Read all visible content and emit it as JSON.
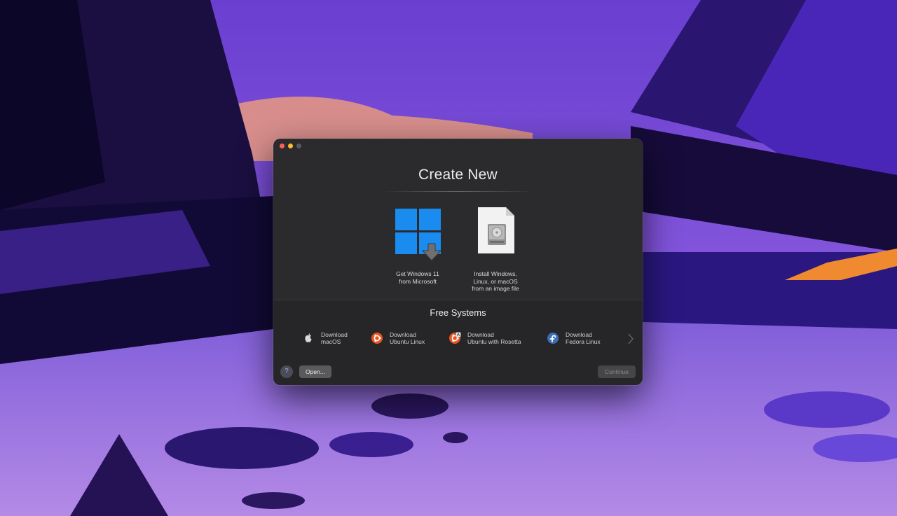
{
  "window": {
    "title": "Create New"
  },
  "options": [
    {
      "label": "Get Windows 11\nfrom Microsoft",
      "icon": "windows-download-icon"
    },
    {
      "label": "Install Windows,\nLinux, or macOS\nfrom an image file",
      "icon": "disk-image-icon"
    }
  ],
  "free_systems": {
    "title": "Free Systems",
    "items": [
      {
        "line1": "Download",
        "line2": "macOS",
        "icon": "apple-icon"
      },
      {
        "line1": "Download",
        "line2": "Ubuntu Linux",
        "icon": "ubuntu-icon"
      },
      {
        "line1": "Download",
        "line2": "Ubuntu with Rosetta",
        "icon": "ubuntu-rosetta-icon"
      },
      {
        "line1": "Download",
        "line2": "Fedora Linux",
        "icon": "fedora-icon"
      }
    ]
  },
  "footer": {
    "help_label": "?",
    "open_label": "Open...",
    "continue_label": "Continue"
  },
  "colors": {
    "windows_blue": "#1a8cf0",
    "ubuntu_orange": "#e95420",
    "fedora_blue": "#3c6eb4",
    "wallpaper_purple": "#7a4fd8"
  }
}
